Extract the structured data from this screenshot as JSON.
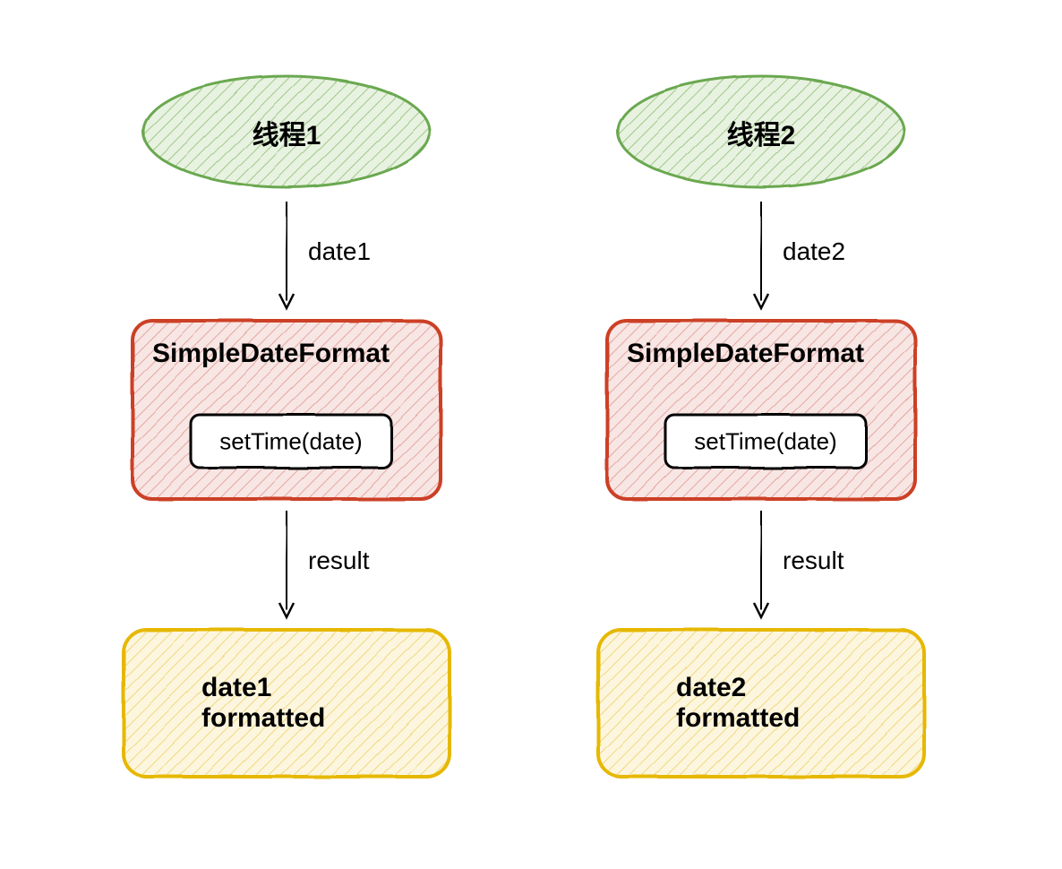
{
  "colors": {
    "green_stroke": "#6aa84f",
    "green_fill": "#b6d7a8",
    "red_stroke": "#cc4125",
    "red_fill": "#ea9999",
    "yellow_stroke": "#e6b800",
    "yellow_fill": "#ffe599",
    "ink": "#000000"
  },
  "left": {
    "thread": "线程1",
    "edge1": "date1",
    "sdf_title": "SimpleDateFormat",
    "sdf_inner": "setTime(date)",
    "edge2": "result",
    "output": "date1 formatted"
  },
  "right": {
    "thread": "线程2",
    "edge1": "date2",
    "sdf_title": "SimpleDateFormat",
    "sdf_inner": "setTime(date)",
    "edge2": "result",
    "output": "date2 formatted"
  }
}
